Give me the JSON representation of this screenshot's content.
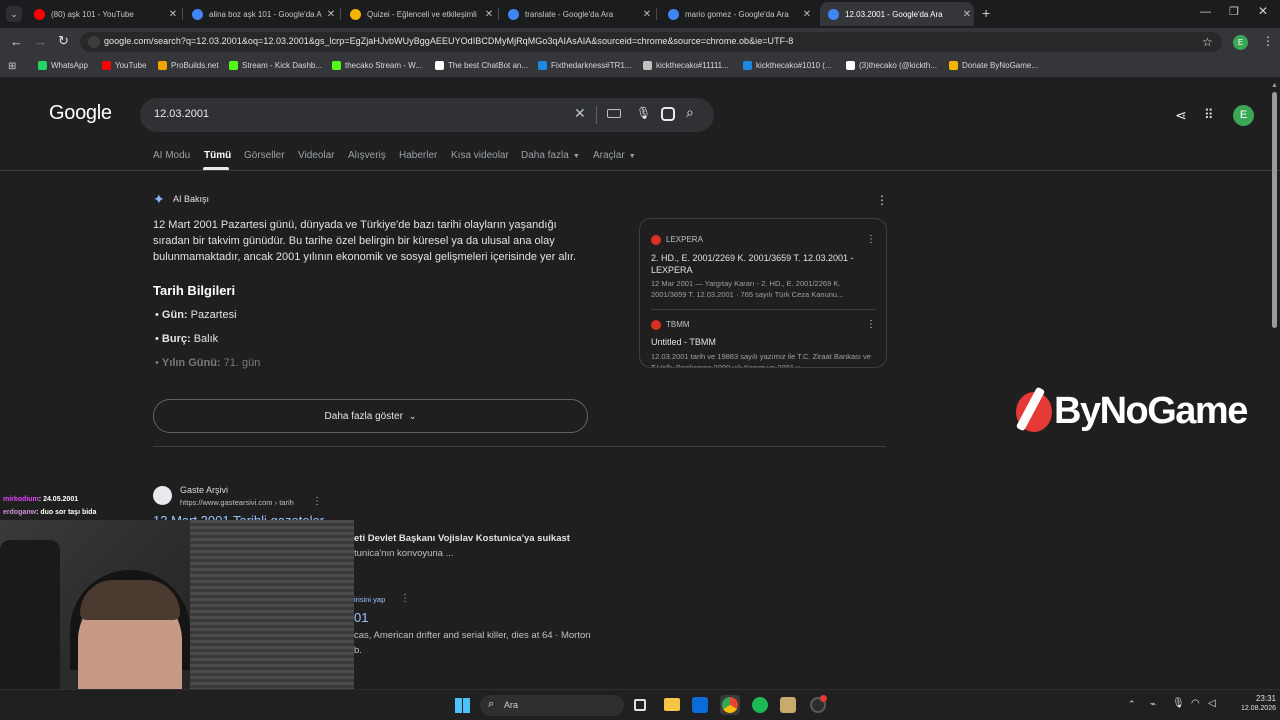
{
  "tabs": [
    {
      "title": "(80) aşk 101 - YouTube",
      "favicon_color": "#ff0000"
    },
    {
      "title": "alina boz aşk 101 - Google'da A",
      "favicon_color": "#4285f4"
    },
    {
      "title": "Quizei - Eğlenceli ve etkileşimli",
      "favicon_color": "#f4b400"
    },
    {
      "title": "translate - Google'da Ara",
      "favicon_color": "#4285f4"
    },
    {
      "title": "mario gomez - Google'da Ara",
      "favicon_color": "#4285f4"
    },
    {
      "title": "12.03.2001 - Google'da Ara",
      "favicon_color": "#4285f4",
      "active": true
    }
  ],
  "new_tab_symbol": "+",
  "url": "google.com/search?q=12.03.2001&oq=12.03.2001&gs_lcrp=EgZjaHJvbWUyBggAEEUYOdIBCDMyMjRqMGo3qAIAsAIA&sourceid=chrome&source=chrome.ob&ie=UTF-8",
  "profile_letter": "E",
  "bookmarks": [
    {
      "label": "WhatsApp",
      "color": "#25d366"
    },
    {
      "label": "YouTube",
      "color": "#ff0000"
    },
    {
      "label": "ProBuilds.net",
      "color": "#f4a300"
    },
    {
      "label": "Stream - Kick Dashb...",
      "color": "#53fc18"
    },
    {
      "label": "thecako Stream - W...",
      "color": "#53fc18"
    },
    {
      "label": "The best ChatBot an...",
      "color": "#ffffff"
    },
    {
      "label": "Fixthedarkness#TR1...",
      "color": "#1e88e5"
    },
    {
      "label": "kickthecako#11111...",
      "color": "#c0c0c0"
    },
    {
      "label": "kickthecako#1010 (...",
      "color": "#1e88e5"
    },
    {
      "label": "(3)thecako (@kickth...",
      "color": "#ffffff"
    },
    {
      "label": "Donate ByNoGame...",
      "color": "#f4b400"
    }
  ],
  "google": {
    "logo": "Google",
    "query": "12.03.2001",
    "profile_letter": "E",
    "nav_tabs": [
      "AI Modu",
      "Tümü",
      "Görseller",
      "Videolar",
      "Alışveriş",
      "Haberler",
      "Kısa videolar",
      "Daha fazla",
      "Araçlar"
    ],
    "active_tab": "Tümü"
  },
  "overview": {
    "header": "AI Bakışı",
    "paragraph": "12 Mart 2001 Pazartesi günü, dünyada ve Türkiye'de bazı tarihi olayların yaşandığı sıradan bir takvim günüdür. Bu tarihe özel belirgin bir küresel ya da ulusal ana olay bulunmamaktadır, ancak 2001 yılının ekonomik ve sosyal gelişmeleri içerisinde yer alır.",
    "section_title": "Tarih Bilgileri",
    "items": [
      {
        "key": "Gün:",
        "value": "Pazartesi"
      },
      {
        "key": "Burç:",
        "value": "Balık"
      },
      {
        "key": "Yılın Günü:",
        "value": "71. gün"
      }
    ],
    "more_button": "Daha fazla göster",
    "sources": [
      {
        "site": "LEXPERA",
        "title": "2. HD., E. 2001/2269 K. 2001/3659 T. 12.03.2001 - LEXPERA",
        "snippet": "12 Mar 2001 — Yargıtay Kararı - 2. HD., E. 2001/2269 K. 2001/3659 T. 12.03.2001 · 765 sayılı Türk Ceza Kanunu..."
      },
      {
        "site": "TBMM",
        "title": "Untitled - TBMM",
        "snippet": "12.03.2001 tarih ve 19883 sayılı yazımız ile T.C. Ziraat Bankası ve T.Halk. Bankasına 2000 yılı Kasım ve 2001 y..."
      }
    ]
  },
  "results": [
    {
      "site": "Gaste Arşivi",
      "url": "https://www.gastearsivi.com › tarih",
      "title": "12 Mart 2001 Tarihli gazeteler",
      "snippet_bold": "eti Devlet Başkanı Vojislav Kostunica'ya suikast",
      "snippet": "tunica'nın konvoyuna ..."
    },
    {
      "url_fragment": "irisini yap",
      "title_fragment": "01",
      "snippet": "cas, American drifter and serial killer, dies at 64 · Morton",
      "snippet2": "b."
    }
  ],
  "overlay": {
    "brand": "ByNoGame",
    "chat": [
      {
        "user": "mirkodium",
        "msg": ": 24.05.2001",
        "color": "#e040fb"
      },
      {
        "user": "erdoganw",
        "msg": ": duo sor taşı bida",
        "color": "#ce93d8"
      }
    ]
  },
  "taskbar": {
    "search_label": "Ara",
    "time": "23:31",
    "date": "12.08.2026"
  }
}
